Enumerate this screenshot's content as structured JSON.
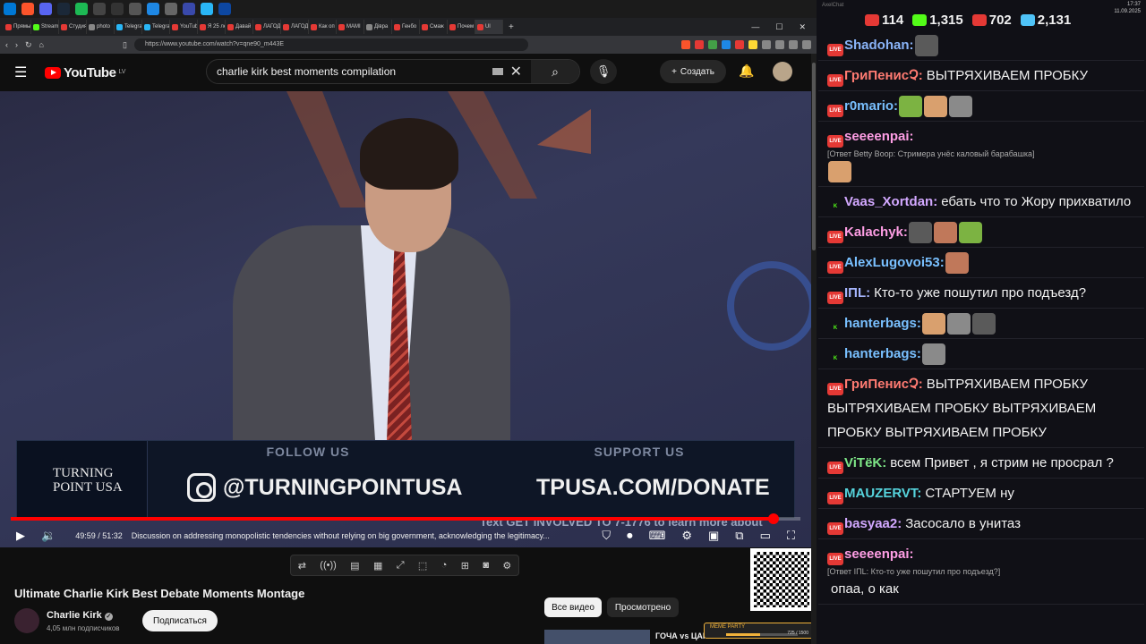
{
  "browser": {
    "tabs": [
      "Прямые",
      "Stream",
      "Студия",
      "photo",
      "Telegra",
      "Telegra",
      "YouTub",
      "Я 25 ле",
      "Давай",
      "ЛАГОД",
      "ЛАГОД",
      "Как оп",
      "MAMI",
      "Дiвра",
      "Генбо",
      "Смаж",
      "Почем",
      "Ul"
    ],
    "url": "https://www.youtube.com/watch?v=qne90_m443E"
  },
  "youtube": {
    "logo_text": "YouTube",
    "logo_country": "LV",
    "search_value": "charlie kirk best moments compilation",
    "create_label": "Создать",
    "video": {
      "banner_left_line1": "TURNING",
      "banner_left_line2": "POINT USA",
      "follow": "FOLLOW US",
      "support": "SUPPORT US",
      "handle": "@TURNINGPOINTUSA",
      "donate": "TPUSA.COM/DONATE",
      "ticker": "Text GET INVOLVED TO 7-1776 to learn more about",
      "progress": 0.9665
    },
    "time": "49:59 / 51:32",
    "chapter": "Discussion on addressing monopolistic tendencies without relying on big government, acknowledging the legitimacy...",
    "title": "Ultimate Charlie Kirk Best Debate Moments Montage",
    "channel": "Charlie Kirk",
    "subs": "4,05 млн подписчиков",
    "subscribe_label": "Подписаться",
    "chip_all": "Все видео",
    "chip_watched": "Просмотрено",
    "rec_title": "ГОЧА vs ЦАР",
    "meme_label": "MEME PARTY",
    "meme_count": "725 / 1500",
    "meme_progress": 0.48
  },
  "chat": {
    "app_label": "AxelChat",
    "clock_time": "17:37",
    "clock_date": "11.09.2025",
    "stats": [
      {
        "value": "114",
        "color": "#e53935"
      },
      {
        "value": "1,315",
        "color": "#53fc18"
      },
      {
        "value": "702",
        "color": "#e53935"
      },
      {
        "value": "2,131",
        "color": "#4fc3f7"
      }
    ],
    "messages": [
      {
        "badge": "live",
        "user": "Shadohan:",
        "color": "#8ab4f8",
        "text": ""
      },
      {
        "badge": "live",
        "user": "ГриПенисՉ:",
        "color": "#ff7b72",
        "text": "ВЫТРЯХИВАЕМ ПРОБКУ"
      },
      {
        "badge": "live",
        "user": "r0mario:",
        "color": "#79c0ff",
        "text": ""
      },
      {
        "badge": "live",
        "user": "seeeenpai:",
        "color": "#ff9ee5",
        "reply": "[Ответ Betty Boop: Стримера унёс каловый барабашка]",
        "text": ""
      },
      {
        "badge": "kick",
        "user": "Vaas_Xortdan:",
        "color": "#d2a8ff",
        "text": "ебать что то Жору прихватило"
      },
      {
        "badge": "live",
        "user": "Kalachyk:",
        "color": "#ff9ee5",
        "text": ""
      },
      {
        "badge": "live",
        "user": "AlexLugovoi53:",
        "color": "#79c0ff",
        "text": ""
      },
      {
        "badge": "live",
        "user": "IПL:",
        "color": "#a5b4fc",
        "text": "Кто-то уже пошутил про подъезд?"
      },
      {
        "badge": "kick",
        "user": "hanterbags:",
        "color": "#79c0ff",
        "text": ""
      },
      {
        "badge": "kick",
        "user": "hanterbags:",
        "color": "#79c0ff",
        "text": ""
      },
      {
        "badge": "live",
        "user": "ГриПенисՉ:",
        "color": "#ff7b72",
        "text": "ВЫТРЯХИВАЕМ ПРОБКУ ВЫТРЯХИВАЕМ ПРОБКУ ВЫТРЯХИВАЕМ ПРОБКУ ВЫТРЯХИВАЕМ ПРОБКУ"
      },
      {
        "badge": "live",
        "user": "ViTёK:",
        "color": "#7ee787",
        "text": "всем Привет , я стрим не просрал ?"
      },
      {
        "badge": "live",
        "user": "MAUZERVT:",
        "color": "#56d4dd",
        "text": "СТАРТУЕМ ну"
      },
      {
        "badge": "live",
        "user": "basyaa2:",
        "color": "#d2a8ff",
        "text": "Засосало в унитаз"
      },
      {
        "badge": "live",
        "user": "seeeenpai:",
        "color": "#ff9ee5",
        "reply": "[Ответ IПL: Кто-то уже пошутил про подъезд?]",
        "text": "опаа, о как"
      }
    ]
  }
}
